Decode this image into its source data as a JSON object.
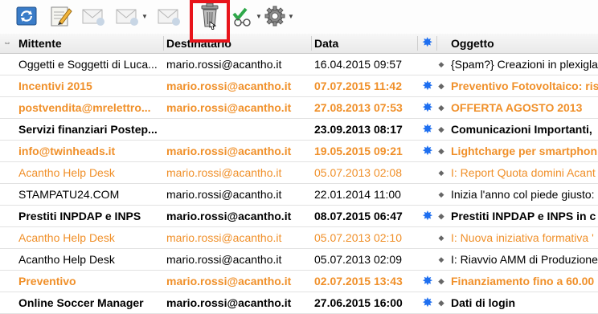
{
  "columns": {
    "from": "Mittente",
    "to": "Destinatario",
    "date": "Data",
    "subject": "Oggetto"
  },
  "colors": {
    "unread_orange": "#f0902a",
    "star_blue": "#1e6ff0",
    "highlight_red": "#e8141b"
  },
  "toolbar": {
    "buttons": [
      {
        "name": "refresh-mail-icon"
      },
      {
        "name": "compose-icon"
      },
      {
        "name": "reply-icon"
      },
      {
        "name": "reply-all-icon"
      },
      {
        "name": "forward-icon"
      },
      {
        "name": "trash-icon"
      },
      {
        "name": "filter-icon"
      },
      {
        "name": "settings-gear-icon"
      }
    ]
  },
  "messages": [
    {
      "from": "Oggetti e Soggetti di Luca...",
      "to": "mario.rossi@acantho.it",
      "date": "16.04.2015 09:57",
      "subject": "{Spam?} Creazioni in plexigla",
      "bold": false,
      "orange": false,
      "star": false
    },
    {
      "from": "Incentivi 2015",
      "to": "mario.rossi@acantho.it",
      "date": "07.07.2015 11:42",
      "subject": "Preventivo Fotovoltaico: ris",
      "bold": true,
      "orange": true,
      "star": true
    },
    {
      "from": "postvendita@mrelettro...",
      "to": "mario.rossi@acantho.it",
      "date": "27.08.2013 07:53",
      "subject": "OFFERTA AGOSTO 2013",
      "bold": true,
      "orange": true,
      "star": true
    },
    {
      "from": "Servizi finanziari Postep...",
      "to": "",
      "date": "23.09.2013 08:17",
      "subject": "Comunicazioni Importanti, ",
      "bold": true,
      "orange": false,
      "star": true
    },
    {
      "from": "info@twinheads.it",
      "to": "mario.rossi@acantho.it",
      "date": "19.05.2015 09:21",
      "subject": "Lightcharge per smartphon",
      "bold": true,
      "orange": true,
      "star": true
    },
    {
      "from": "Acantho Help Desk",
      "to": "mario.rossi@acantho.it",
      "date": "05.07.2013 02:08",
      "subject": "I: Report Quota domini Acant",
      "bold": false,
      "orange": true,
      "star": false
    },
    {
      "from": "STAMPATU24.COM",
      "to": "mario.rossi@acantho.it",
      "date": "22.01.2014 11:00",
      "subject": "Inizia l'anno col piede giusto:",
      "bold": false,
      "orange": false,
      "star": false
    },
    {
      "from": "Prestiti INPDAP e INPS",
      "to": "mario.rossi@acantho.it",
      "date": "08.07.2015 06:47",
      "subject": "Prestiti INPDAP e INPS in c",
      "bold": true,
      "orange": false,
      "star": true
    },
    {
      "from": "Acantho Help Desk",
      "to": "mario.rossi@acantho.it",
      "date": "05.07.2013 02:10",
      "subject": "I: Nuova iniziativa formativa '",
      "bold": false,
      "orange": true,
      "star": false
    },
    {
      "from": "Acantho Help Desk",
      "to": "mario.rossi@acantho.it",
      "date": "05.07.2013 02:09",
      "subject": "I: Riavvio AMM di Produzione",
      "bold": false,
      "orange": false,
      "star": false
    },
    {
      "from": "Preventivo",
      "to": "mario.rossi@acantho.it",
      "date": "02.07.2015 13:43",
      "subject": "Finanziamento fino a 60.00",
      "bold": true,
      "orange": true,
      "star": true
    },
    {
      "from": "Online Soccer Manager",
      "to": "mario.rossi@acantho.it",
      "date": "27.06.2015 16:00",
      "subject": "Dati di login",
      "bold": true,
      "orange": false,
      "star": true
    }
  ]
}
